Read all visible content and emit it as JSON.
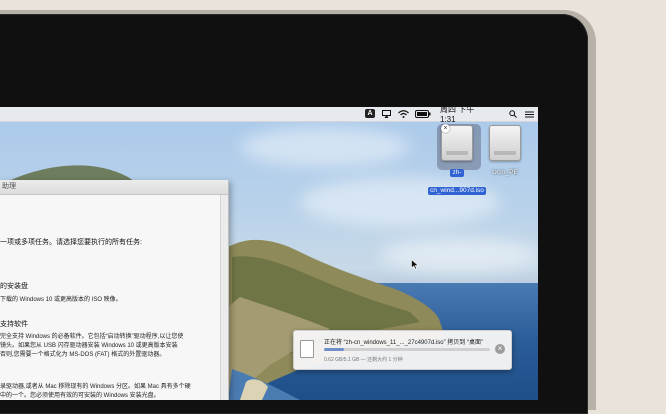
{
  "menubar": {
    "input_badge": "A",
    "clock": "周四 下午 1:31"
  },
  "desktop": {
    "icons": [
      {
        "label_line1": "zh-",
        "label_line2": "cn_wind...907d.iso",
        "selected": true
      },
      {
        "label": "Ucm_PE",
        "selected": false
      }
    ]
  },
  "bootcamp": {
    "title": "助理",
    "intro": "一项或多项任务。请选择您要执行的所有任务:",
    "task1_title": "的安装盘",
    "task1_desc": "下载的 Windows 10 或更高版本的 ISO 映像。",
    "task2_title": "支持软件",
    "task2_desc1": "完全支持 Windows 的必备软件。它包括“启动转换”驱动程序,以让您使",
    "task2_desc2": "镜头。如果您从 USB 闪存驱动器安装 Windows 10 或更高版本安装",
    "task2_desc3": "否则,您需要一个格式化为 MS-DOS (FAT) 格式的外置驱动器。",
    "task3_desc1": "录驱动器,或者从 Mac 移除现有的 Windows 分区。如果 Mac 具有多个硬",
    "task3_desc2": "中的一个。您必须使用有效的可安装的 Windows 安装光盘。"
  },
  "copy_progress": {
    "title": "正在将 “zh-cn_windows_11_..._27c4907d.iso” 拷贝到 “桌面”",
    "subtitle": "0.62 GB/5.1 GB — 还剩大约 1 分钟",
    "progress": 0.12
  },
  "colors": {
    "selection": "#2f63d3",
    "progress_fill": "#6f8ec9",
    "bezel": "#101011"
  }
}
